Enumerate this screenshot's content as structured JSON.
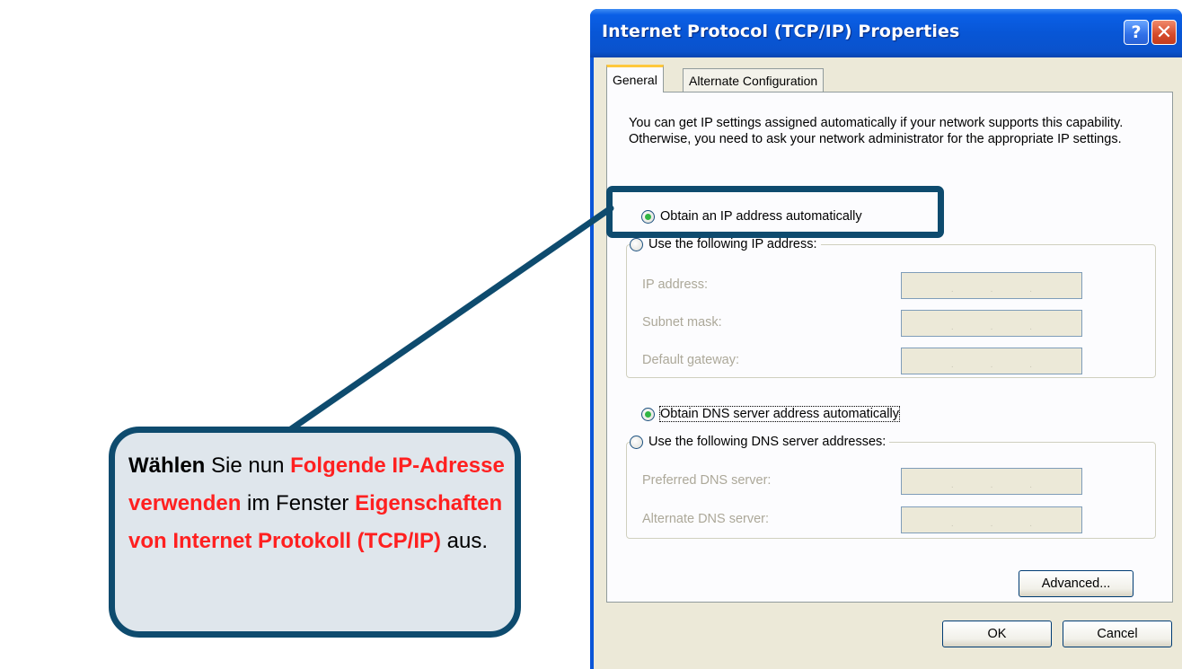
{
  "window": {
    "title": "Internet Protocol (TCP/IP) Properties",
    "help_icon": "?",
    "close_icon": "✕"
  },
  "tabs": [
    {
      "label": "General"
    },
    {
      "label": "Alternate Configuration"
    }
  ],
  "description": "You can get IP settings assigned automatically if your network supports this capability. Otherwise, you need to ask your network administrator for the appropriate IP settings.",
  "ip_section": {
    "auto_label": "Obtain an IP address automatically",
    "manual_label": "Use the following IP address:",
    "selected": "auto",
    "fields": [
      {
        "label": "IP address:"
      },
      {
        "label": "Subnet mask:"
      },
      {
        "label": "Default gateway:"
      }
    ]
  },
  "dns_section": {
    "auto_label": "Obtain DNS server address automatically",
    "manual_label": "Use the following DNS server addresses:",
    "selected": "auto",
    "fields": [
      {
        "label": "Preferred DNS server:"
      },
      {
        "label": "Alternate DNS server:"
      }
    ]
  },
  "buttons": {
    "advanced": "Advanced...",
    "ok": "OK",
    "cancel": "Cancel"
  },
  "ip_dot": ".",
  "callout": {
    "part1": "Wählen",
    "part2": " Sie nun ",
    "part3": "Folgende IP-Adresse verwenden",
    "part4": " im Fenster ",
    "part5": "Eigenschaften von Internet Protokoll (TCP/IP)",
    "part6": " aus."
  },
  "colors": {
    "callout_border": "#0e4b6e",
    "callout_fill": "#dfe6ec",
    "highlight_text": "#ff2020",
    "titlebar": "#0856d6"
  }
}
